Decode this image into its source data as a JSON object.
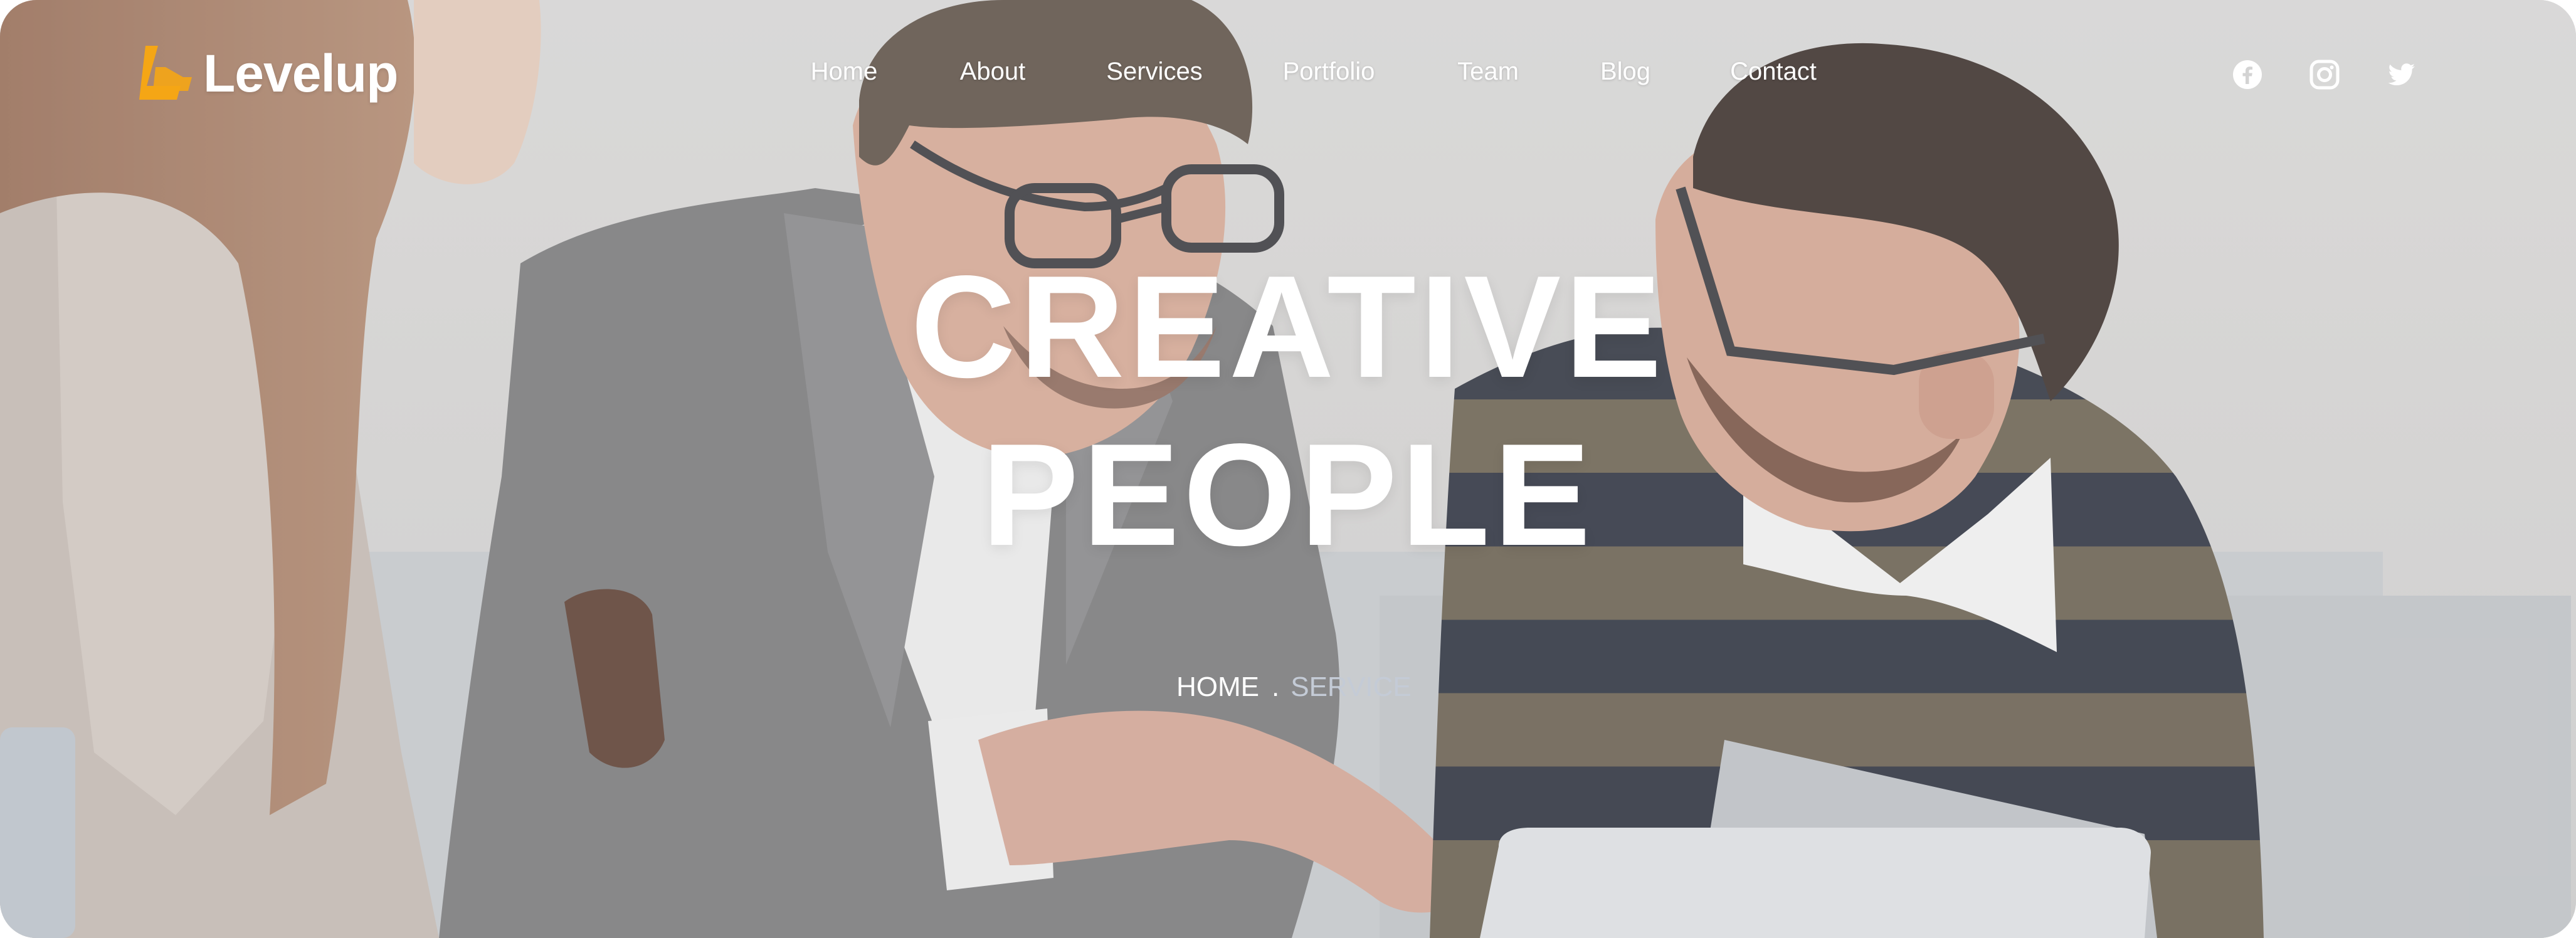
{
  "brand": {
    "name": "Levelup",
    "accent_color": "#f5a615"
  },
  "nav": {
    "items": [
      {
        "label": "Home"
      },
      {
        "label": "About"
      },
      {
        "label": "Services"
      },
      {
        "label": "Portfolio"
      },
      {
        "label": "Team"
      },
      {
        "label": "Blog"
      },
      {
        "label": "Contact"
      }
    ]
  },
  "social": [
    {
      "icon": "facebook-icon"
    },
    {
      "icon": "instagram-icon"
    },
    {
      "icon": "twitter-icon"
    }
  ],
  "hero": {
    "title_line1": "CREATIVE",
    "title_line2": "PEOPLE",
    "breadcrumb": {
      "home": "HOME",
      "separator": ".",
      "current": "SERVICE"
    }
  }
}
